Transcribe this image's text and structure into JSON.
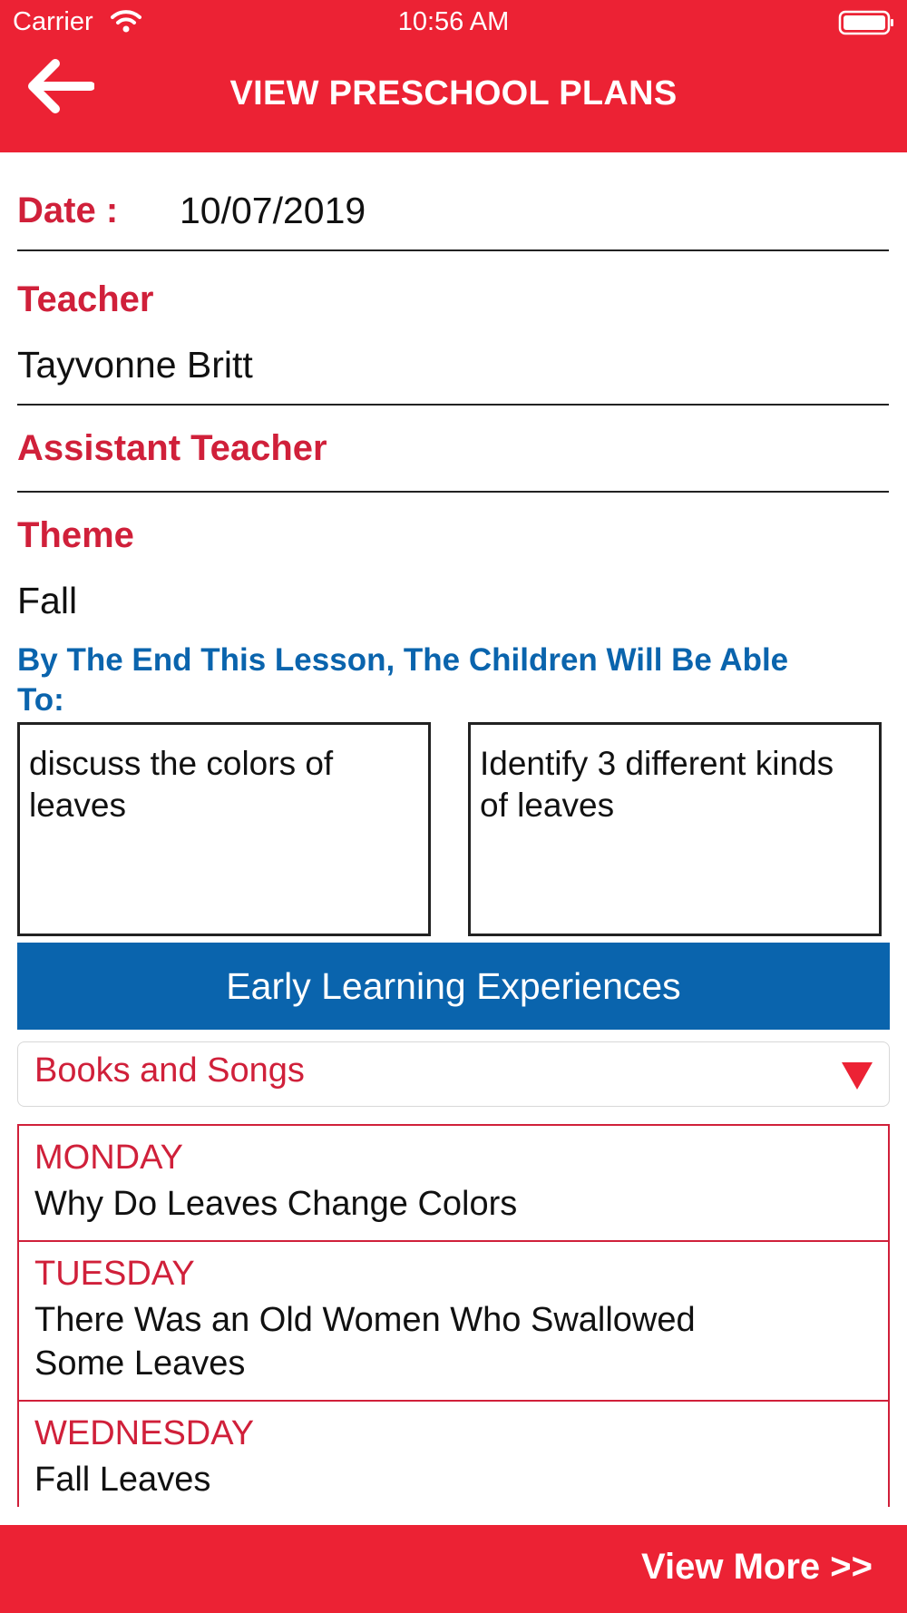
{
  "status_bar": {
    "carrier": "Carrier",
    "time": "10:56 AM"
  },
  "header": {
    "title": "VIEW PRESCHOOL PLANS"
  },
  "form": {
    "date_label": "Date :",
    "date_value": "10/07/2019",
    "teacher_label": "Teacher",
    "teacher_value": "Tayvonne Britt",
    "assistant_label": "Assistant Teacher",
    "theme_label": "Theme",
    "theme_value": "Fall"
  },
  "objectives": {
    "heading": "By The End This Lesson, The Children Will Be Able To:",
    "items": [
      "discuss the colors of leaves",
      "Identify 3 different kinds of leaves"
    ]
  },
  "experiences": {
    "title": "Early Learning Experiences",
    "selected": "Books and Songs"
  },
  "schedule": [
    {
      "day": "MONDAY",
      "item": "Why Do Leaves Change Colors"
    },
    {
      "day": "TUESDAY",
      "item": "There Was an Old Women Who Swallowed Some Leaves"
    },
    {
      "day": "WEDNESDAY",
      "item": "Fall Leaves"
    }
  ],
  "footer": {
    "view_more": "View More >>"
  },
  "colors": {
    "header_red": "#ec2234",
    "label_red": "#d0203a",
    "accent_blue": "#0a64ad"
  },
  "icons": [
    "wifi-icon",
    "battery-icon",
    "back-arrow-icon",
    "dropdown-caret-icon"
  ]
}
